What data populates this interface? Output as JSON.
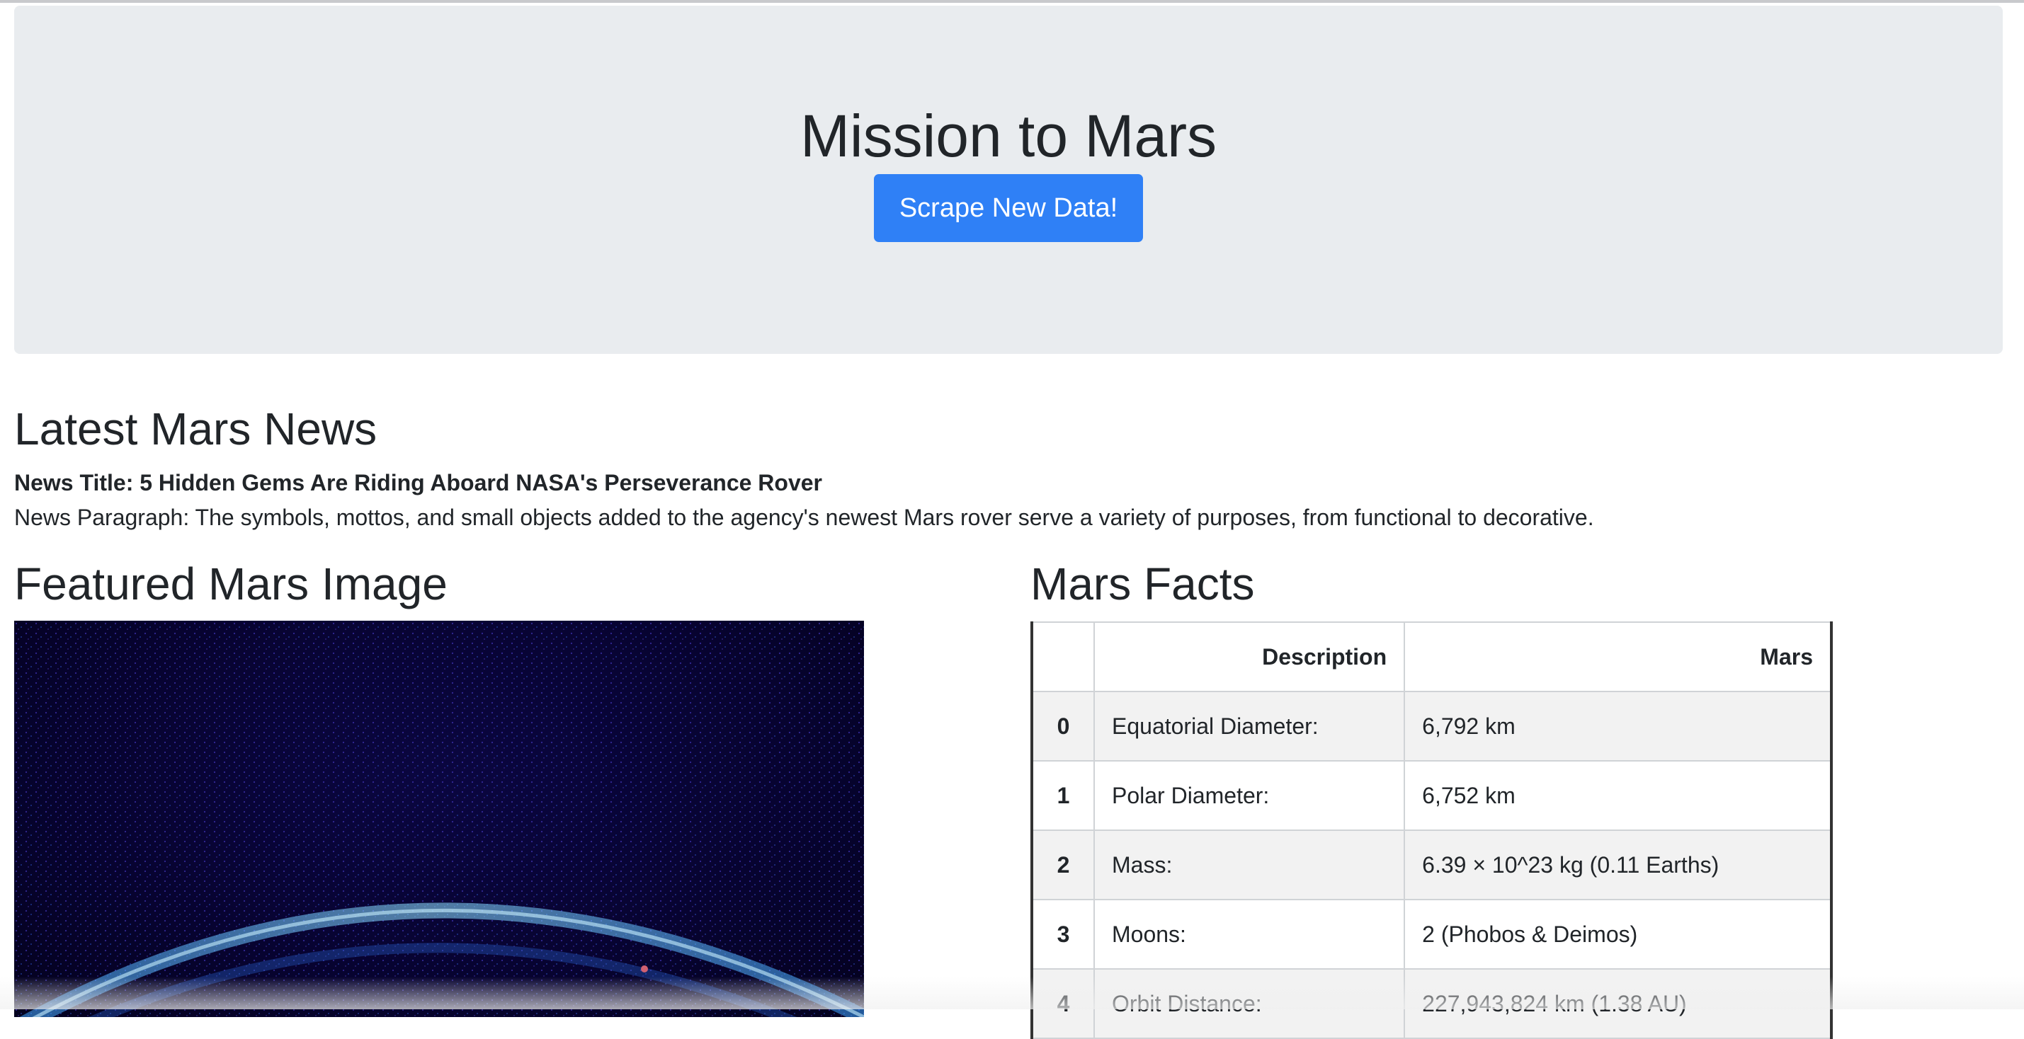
{
  "header": {
    "title": "Mission to Mars",
    "scrape_button_label": "Scrape New Data!"
  },
  "news": {
    "heading": "Latest Mars News",
    "title": "News Title: 5 Hidden Gems Are Riding Aboard NASA's Perseverance Rover",
    "paragraph": "News Paragraph: The symbols, mottos, and small objects added to the agency's newest Mars rover serve a variety of purposes, from functional to decorative."
  },
  "featured_image": {
    "heading": "Featured Mars Image"
  },
  "facts": {
    "heading": "Mars Facts",
    "columns": [
      "",
      "Description",
      "Mars"
    ],
    "rows": [
      {
        "index": "0",
        "description": "Equatorial Diameter:",
        "value": "6,792 km"
      },
      {
        "index": "1",
        "description": "Polar Diameter:",
        "value": "6,752 km"
      },
      {
        "index": "2",
        "description": "Mass:",
        "value": "6.39 × 10^23 kg (0.11 Earths)"
      },
      {
        "index": "3",
        "description": "Moons:",
        "value": "2 (Phobos & Deimos)"
      },
      {
        "index": "4",
        "description": "Orbit Distance:",
        "value": "227,943,824 km (1.38 AU)"
      }
    ]
  }
}
